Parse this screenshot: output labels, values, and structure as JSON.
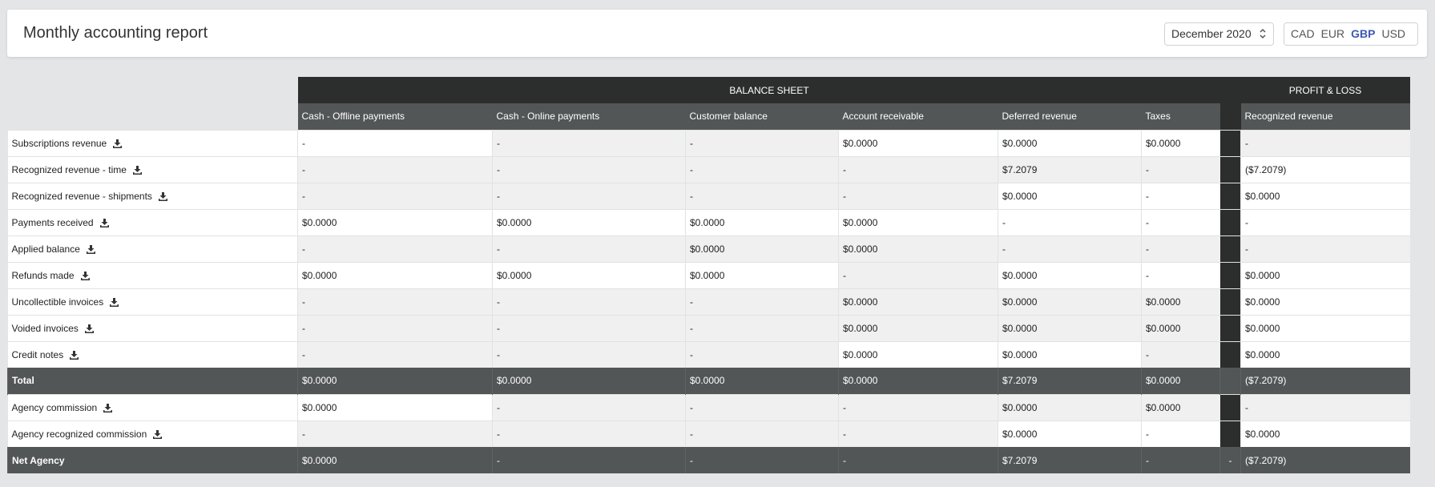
{
  "header": {
    "title": "Monthly accounting report",
    "month": "December 2020",
    "currencies": [
      "CAD",
      "EUR",
      "GBP",
      "USD"
    ],
    "active_currency": "GBP"
  },
  "table": {
    "band_balance": "BALANCE SHEET",
    "band_pl": "PROFIT & LOSS",
    "columns": [
      "Cash - Offline payments",
      "Cash - Online payments",
      "Customer balance",
      "Account receivable",
      "Deferred revenue",
      "Taxes",
      "Recognized revenue"
    ],
    "rows": [
      {
        "label": "Subscriptions revenue",
        "download": true,
        "type": "data",
        "values": [
          "-",
          "-",
          "-",
          "$0.0000",
          "$0.0000",
          "$0.0000",
          "-"
        ],
        "gap": ""
      },
      {
        "label": "Recognized revenue - time",
        "download": true,
        "type": "data",
        "values": [
          "-",
          "-",
          "-",
          "-",
          "$7.2079",
          "-",
          "($7.2079)"
        ],
        "gap": ""
      },
      {
        "label": "Recognized revenue - shipments",
        "download": true,
        "type": "data",
        "values": [
          "-",
          "-",
          "-",
          "-",
          "$0.0000",
          "-",
          "$0.0000"
        ],
        "gap": ""
      },
      {
        "label": "Payments received",
        "download": true,
        "type": "data",
        "values": [
          "$0.0000",
          "$0.0000",
          "$0.0000",
          "$0.0000",
          "-",
          "-",
          "-"
        ],
        "gap": ""
      },
      {
        "label": "Applied balance",
        "download": true,
        "type": "data",
        "values": [
          "-",
          "-",
          "$0.0000",
          "$0.0000",
          "-",
          "-",
          "-"
        ],
        "gap": ""
      },
      {
        "label": "Refunds made",
        "download": true,
        "type": "data",
        "values": [
          "$0.0000",
          "$0.0000",
          "$0.0000",
          "-",
          "$0.0000",
          "-",
          "$0.0000"
        ],
        "gap": ""
      },
      {
        "label": "Uncollectible invoices",
        "download": true,
        "type": "data",
        "values": [
          "-",
          "-",
          "-",
          "$0.0000",
          "$0.0000",
          "$0.0000",
          "$0.0000"
        ],
        "gap": ""
      },
      {
        "label": "Voided invoices",
        "download": true,
        "type": "data",
        "values": [
          "-",
          "-",
          "-",
          "$0.0000",
          "$0.0000",
          "$0.0000",
          "$0.0000"
        ],
        "gap": ""
      },
      {
        "label": "Credit notes",
        "download": true,
        "type": "data",
        "values": [
          "-",
          "-",
          "-",
          "$0.0000",
          "$0.0000",
          "-",
          "$0.0000"
        ],
        "gap": ""
      },
      {
        "label": "Total",
        "download": false,
        "type": "total",
        "values": [
          "$0.0000",
          "$0.0000",
          "$0.0000",
          "$0.0000",
          "$7.2079",
          "$0.0000",
          "($7.2079)"
        ],
        "gap": ""
      },
      {
        "label": "Agency commission",
        "download": true,
        "type": "data",
        "values": [
          "$0.0000",
          "-",
          "-",
          "-",
          "$0.0000",
          "$0.0000",
          "-"
        ],
        "gap": ""
      },
      {
        "label": "Agency recognized commission",
        "download": true,
        "type": "data",
        "values": [
          "-",
          "-",
          "-",
          "-",
          "$0.0000",
          "-",
          "$0.0000"
        ],
        "gap": ""
      },
      {
        "label": "Net Agency",
        "download": false,
        "type": "total",
        "values": [
          "$0.0000",
          "-",
          "-",
          "-",
          "$7.2079",
          "-",
          "($7.2079)"
        ],
        "gap": "-"
      }
    ],
    "shading": [
      [
        "w",
        "g",
        "g",
        "w",
        "w",
        "w",
        "g"
      ],
      [
        "g",
        "g",
        "g",
        "g",
        "g",
        "g",
        "w"
      ],
      [
        "g",
        "g",
        "g",
        "g",
        "w",
        "w",
        "w"
      ],
      [
        "w",
        "w",
        "w",
        "w",
        "w",
        "w",
        "w"
      ],
      [
        "g",
        "g",
        "g",
        "g",
        "g",
        "g",
        "g"
      ],
      [
        "w",
        "w",
        "w",
        "g",
        "w",
        "w",
        "w"
      ],
      [
        "g",
        "g",
        "g",
        "g",
        "g",
        "g",
        "w"
      ],
      [
        "g",
        "g",
        "g",
        "g",
        "g",
        "g",
        "w"
      ],
      [
        "g",
        "g",
        "g",
        "w",
        "w",
        "g",
        "w"
      ],
      [
        "t",
        "t",
        "t",
        "t",
        "t",
        "t",
        "t"
      ],
      [
        "w",
        "g",
        "g",
        "g",
        "g",
        "g",
        "g"
      ],
      [
        "g",
        "g",
        "g",
        "g",
        "w",
        "w",
        "w"
      ],
      [
        "t",
        "t",
        "t",
        "t",
        "t",
        "t",
        "t"
      ]
    ]
  }
}
